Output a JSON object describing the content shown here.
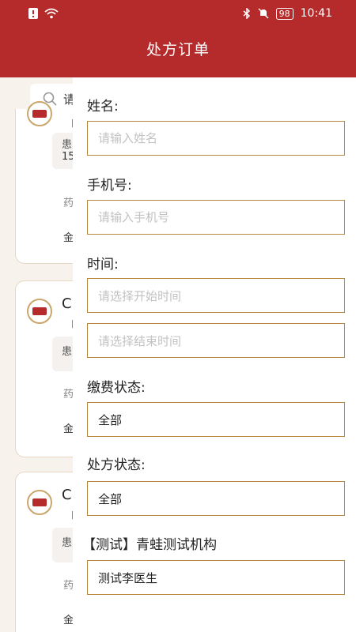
{
  "status_bar": {
    "time": "10:41",
    "battery": "98"
  },
  "header": {
    "title": "处方订单"
  },
  "background": {
    "search_placeholder": "请",
    "cards": [
      {
        "bracket": "【",
        "patient": "患",
        "patient_sub": "15",
        "drug": "药",
        "amount": "金"
      },
      {
        "name": "C",
        "bracket": "【",
        "patient": "患",
        "drug": "药",
        "amount": "金"
      },
      {
        "name": "C",
        "bracket": "【",
        "patient": "患",
        "drug": "药",
        "amount": "金"
      }
    ]
  },
  "filter": {
    "name_label": "姓名:",
    "name_placeholder": "请输入姓名",
    "phone_label": "手机号:",
    "phone_placeholder": "请输入手机号",
    "time_label": "时间:",
    "start_time_placeholder": "请选择开始时间",
    "end_time_placeholder": "请选择结束时间",
    "payment_status_label": "缴费状态:",
    "payment_status_value": "全部",
    "prescription_status_label": "处方状态:",
    "prescription_status_value": "全部",
    "institution": "【测试】青蛙测试机构",
    "doctor_value": "测试李医生"
  },
  "colors": {
    "header": "#b52a2a",
    "field_border": "#b68a3e"
  }
}
